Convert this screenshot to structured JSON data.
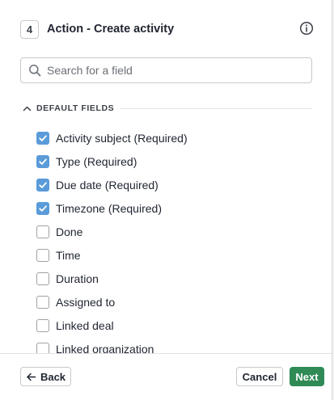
{
  "header": {
    "step_number": "4",
    "title": "Action - Create activity"
  },
  "search": {
    "placeholder": "Search for a field"
  },
  "section": {
    "label": "DEFAULT FIELDS"
  },
  "fields": [
    {
      "label": "Activity subject (Required)",
      "checked": true
    },
    {
      "label": "Type (Required)",
      "checked": true
    },
    {
      "label": "Due date (Required)",
      "checked": true
    },
    {
      "label": "Timezone (Required)",
      "checked": true
    },
    {
      "label": "Done",
      "checked": false
    },
    {
      "label": "Time",
      "checked": false
    },
    {
      "label": "Duration",
      "checked": false
    },
    {
      "label": "Assigned to",
      "checked": false
    },
    {
      "label": "Linked deal",
      "checked": false
    },
    {
      "label": "Linked organization",
      "checked": false
    }
  ],
  "footer": {
    "back_label": "Back",
    "cancel_label": "Cancel",
    "next_label": "Next"
  },
  "colors": {
    "checkbox_checked": "#5b9bd9",
    "primary_button": "#2f8a56"
  },
  "icons": {
    "info": "info-icon",
    "search": "search-icon",
    "section_toggle": "chevron-up-icon",
    "back": "arrow-left-icon",
    "check": "check-icon"
  }
}
